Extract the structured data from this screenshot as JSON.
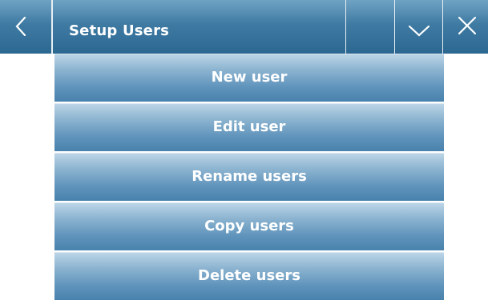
{
  "header": {
    "title": "Setup Users",
    "back_icon": "chevron-left-icon",
    "dropdown_icon": "chevron-down-icon",
    "close_icon": "close-icon"
  },
  "menu": {
    "items": [
      {
        "label": "New user"
      },
      {
        "label": "Edit user"
      },
      {
        "label": "Rename users"
      },
      {
        "label": "Copy users"
      },
      {
        "label": "Delete users"
      }
    ]
  },
  "colors": {
    "header_gradient_top": "#6fa3c4",
    "header_gradient_bottom": "#2b6891",
    "button_gradient_top": "#bcd5e7",
    "button_gradient_bottom": "#4882ad",
    "text": "#ffffff"
  }
}
